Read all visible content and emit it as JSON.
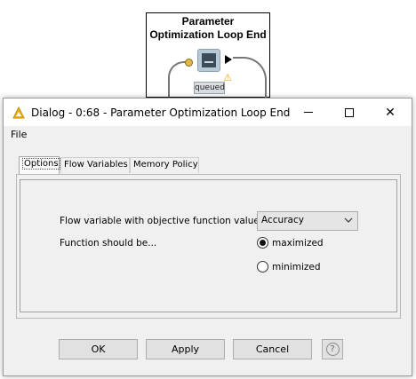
{
  "node": {
    "title_line1": "Parameter",
    "title_line2": "Optimization Loop End",
    "status": "queued",
    "icon": "loop-end-node-icon",
    "warning_icon": "warning-icon"
  },
  "dialog": {
    "title": "Dialog - 0:68 - Parameter Optimization Loop End",
    "title_icon": "knime-triangle-icon",
    "window_controls": {
      "minimize": "minimize-icon",
      "maximize": "maximize-icon",
      "close_glyph": "✕"
    },
    "menu": {
      "file": "File"
    },
    "tabs": [
      {
        "label": "Options",
        "active": true
      },
      {
        "label": "Flow Variables",
        "active": false
      },
      {
        "label": "Memory Policy",
        "active": false
      }
    ],
    "options": {
      "flow_variable_label": "Flow variable with objective function value",
      "flow_variable_value": "Accuracy",
      "function_label": "Function should be...",
      "radio_maximized": "maximized",
      "radio_minimized": "minimized",
      "selected": "maximized"
    },
    "buttons": {
      "ok": "OK",
      "apply": "Apply",
      "cancel": "Cancel",
      "help_glyph": "?"
    }
  },
  "colors": {
    "dialog_bg": "#f0f0f0",
    "title_icon": "#f0b400",
    "node_port": "#e0b94c"
  }
}
